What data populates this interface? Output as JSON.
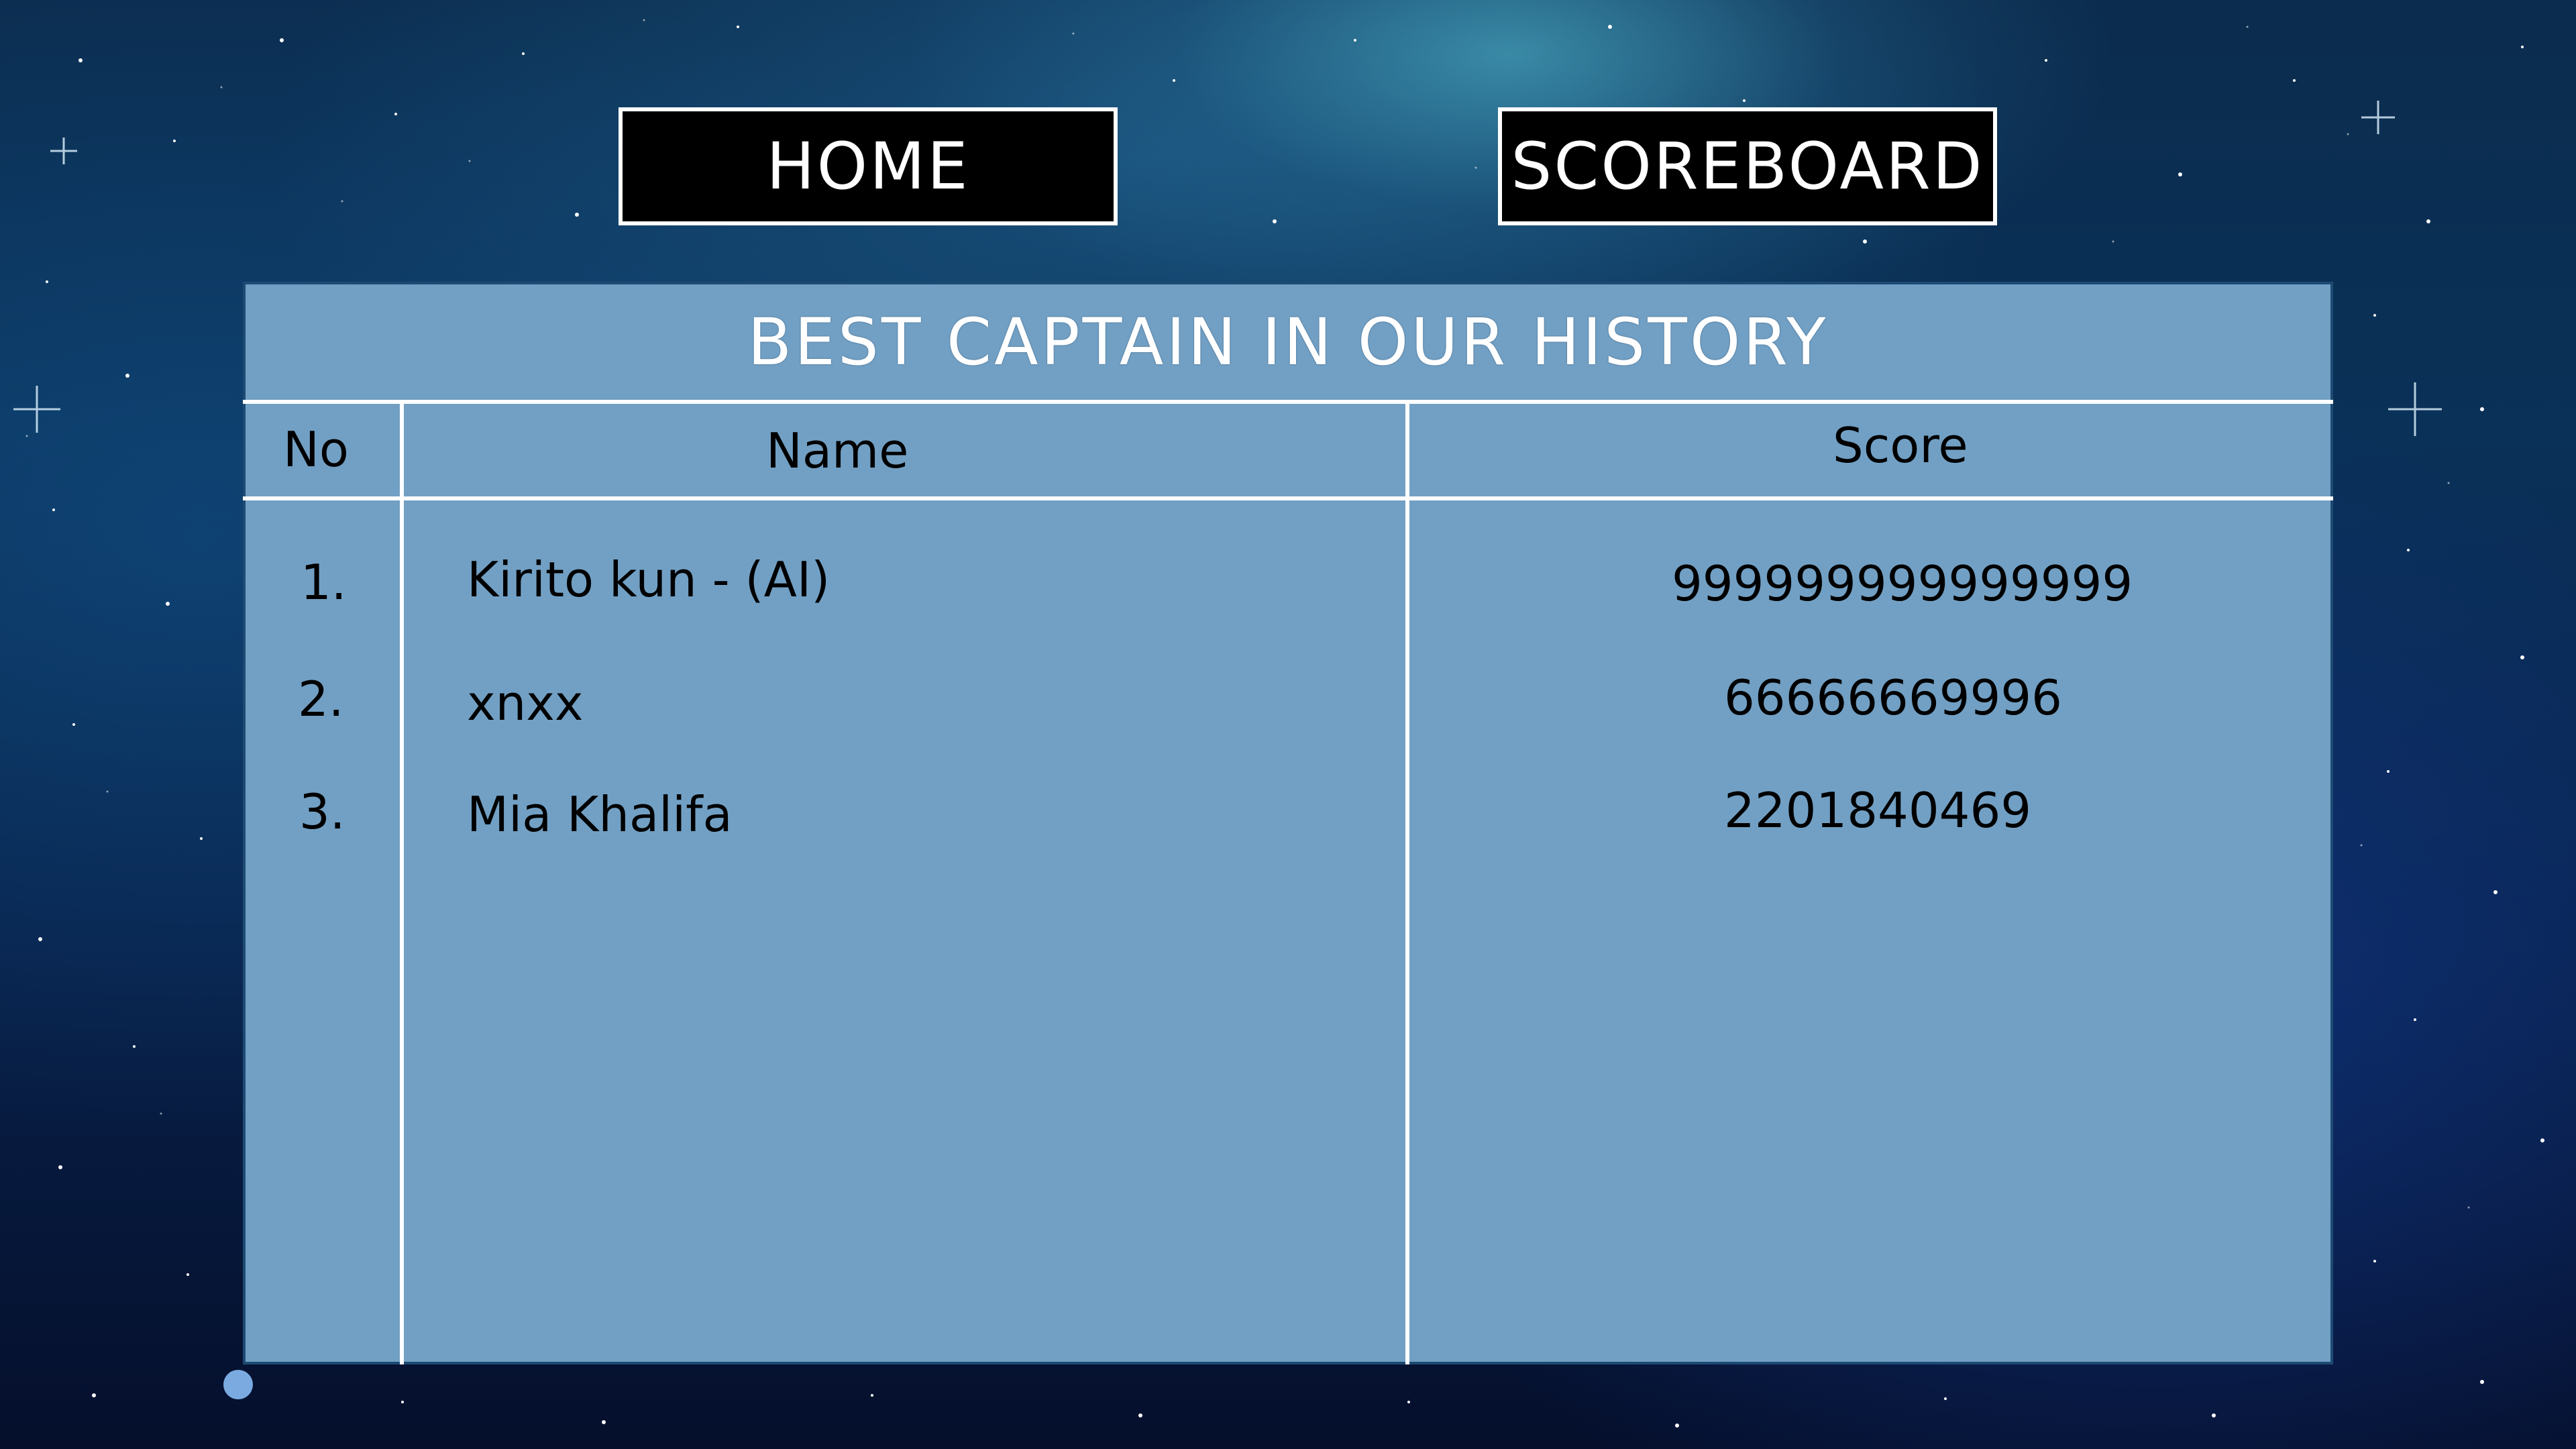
{
  "nav": {
    "home_label": "HOME",
    "scoreboard_label": "SCOREBOARD"
  },
  "board": {
    "title": "BEST CAPTAIN IN OUR HISTORY",
    "columns": {
      "no": "No",
      "name": "Name",
      "score": "Score"
    },
    "rows": [
      {
        "no": "1.",
        "name": "Kirito kun - (AI)",
        "score": "999999999999999"
      },
      {
        "no": "2.",
        "name": "xnxx",
        "score": "66666669996"
      },
      {
        "no": "3.",
        "name": "Mia Khalifa",
        "score": "2201840469"
      }
    ]
  },
  "colors": {
    "board_bg": "#72a0c4",
    "button_bg": "#000000",
    "button_border": "#ffffff",
    "divider": "#ffffff"
  }
}
